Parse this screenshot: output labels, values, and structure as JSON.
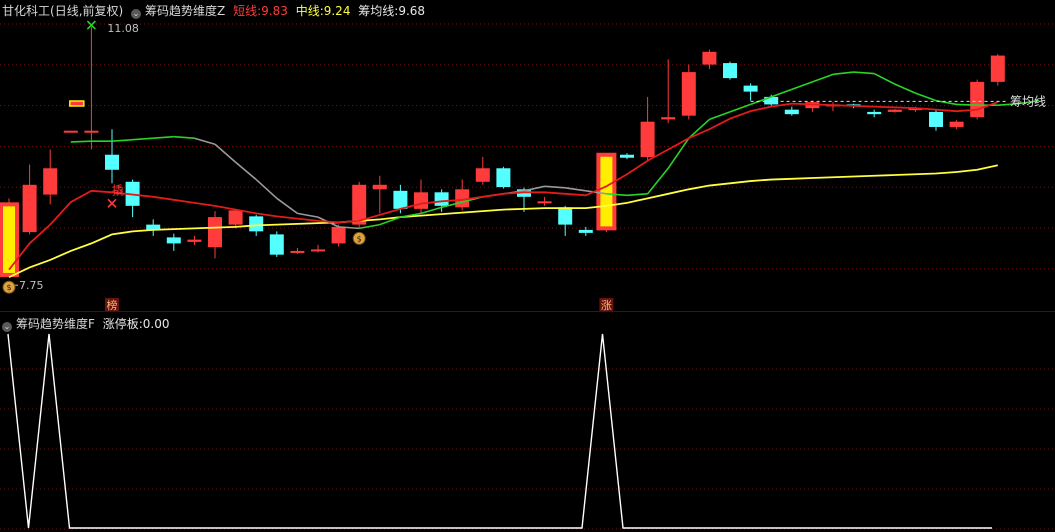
{
  "header": {
    "stock_name": "甘化科工",
    "period_label": "(日线,前复权)",
    "indicator": "筹码趋势维度Z",
    "short_label": "短线:",
    "short_value": "9.83",
    "mid_label": "中线:",
    "mid_value": "9.24",
    "avg_label": "筹均线:",
    "avg_value": "9.68"
  },
  "sub_header": {
    "indicator": "筹码趋势维度F",
    "label": "涨停板:",
    "value": "0.00"
  },
  "annotations": {
    "high_price": "11.08",
    "low_price": "7.75",
    "avg_line_label": "筹均线",
    "marker_escape": "撬",
    "marker_bar_1": "榜",
    "marker_bar_2": "涨"
  },
  "colors": {
    "up": "#ff3b3b",
    "down": "#54ffff",
    "short_line": "#e21b1b",
    "mid_line_up": "#ffff40",
    "trend_green": "#28d428",
    "trend_grey": "#9a9a9a",
    "grid": "#7a1010",
    "limit_up_fill": "#ffee00",
    "sub_line": "#ffffff"
  },
  "chart_data": [
    {
      "type": "candlestick",
      "title": "筹码趋势维度Z",
      "ylim": [
        7.5,
        11.2
      ],
      "high_annotation": 11.08,
      "low_annotation": 7.75,
      "candles": [
        {
          "o": 7.78,
          "c": 8.72,
          "h": 8.8,
          "l": 7.75,
          "limit_up": true
        },
        {
          "o": 8.35,
          "c": 8.98,
          "h": 9.25,
          "l": 8.32
        },
        {
          "o": 8.85,
          "c": 9.2,
          "h": 9.45,
          "l": 8.72
        },
        {
          "o": 9.7,
          "c": 9.7,
          "h": 9.7,
          "l": 9.7
        },
        {
          "o": 9.7,
          "c": 9.7,
          "h": 11.08,
          "l": 9.45
        },
        {
          "o": 9.38,
          "c": 9.18,
          "h": 9.72,
          "l": 9.0
        },
        {
          "o": 9.02,
          "c": 8.7,
          "h": 9.05,
          "l": 8.55
        },
        {
          "o": 8.45,
          "c": 8.38,
          "h": 8.52,
          "l": 8.3
        },
        {
          "o": 8.28,
          "c": 8.2,
          "h": 8.33,
          "l": 8.1
        },
        {
          "o": 8.22,
          "c": 8.25,
          "h": 8.3,
          "l": 8.18
        },
        {
          "o": 8.15,
          "c": 8.55,
          "h": 8.63,
          "l": 8.0
        },
        {
          "o": 8.45,
          "c": 8.64,
          "h": 8.66,
          "l": 8.4
        },
        {
          "o": 8.56,
          "c": 8.36,
          "h": 8.58,
          "l": 8.3
        },
        {
          "o": 8.32,
          "c": 8.05,
          "h": 8.36,
          "l": 8.02
        },
        {
          "o": 8.1,
          "c": 8.1,
          "h": 8.14,
          "l": 8.06
        },
        {
          "o": 8.12,
          "c": 8.12,
          "h": 8.18,
          "l": 8.08
        },
        {
          "o": 8.2,
          "c": 8.42,
          "h": 8.45,
          "l": 8.16
        },
        {
          "o": 8.45,
          "c": 8.98,
          "h": 9.02,
          "l": 8.4
        },
        {
          "o": 8.92,
          "c": 8.98,
          "h": 9.1,
          "l": 8.6
        },
        {
          "o": 8.9,
          "c": 8.66,
          "h": 8.98,
          "l": 8.6
        },
        {
          "o": 8.66,
          "c": 8.88,
          "h": 9.05,
          "l": 8.6
        },
        {
          "o": 8.88,
          "c": 8.7,
          "h": 8.92,
          "l": 8.62
        },
        {
          "o": 8.68,
          "c": 8.92,
          "h": 9.05,
          "l": 8.64
        },
        {
          "o": 9.02,
          "c": 9.2,
          "h": 9.35,
          "l": 8.98
        },
        {
          "o": 9.2,
          "c": 8.95,
          "h": 9.22,
          "l": 8.93
        },
        {
          "o": 8.92,
          "c": 8.82,
          "h": 8.94,
          "l": 8.62
        },
        {
          "o": 8.76,
          "c": 8.76,
          "h": 8.82,
          "l": 8.7
        },
        {
          "o": 8.68,
          "c": 8.45,
          "h": 8.7,
          "l": 8.3
        },
        {
          "o": 8.38,
          "c": 8.34,
          "h": 8.42,
          "l": 8.3
        },
        {
          "o": 8.4,
          "c": 9.38,
          "h": 9.4,
          "l": 8.35,
          "limit_up": true
        },
        {
          "o": 9.38,
          "c": 9.34,
          "h": 9.4,
          "l": 9.32
        },
        {
          "o": 9.35,
          "c": 9.82,
          "h": 10.15,
          "l": 9.3
        },
        {
          "o": 9.85,
          "c": 9.88,
          "h": 10.65,
          "l": 9.8
        },
        {
          "o": 9.9,
          "c": 10.48,
          "h": 10.58,
          "l": 9.85
        },
        {
          "o": 10.58,
          "c": 10.75,
          "h": 10.78,
          "l": 10.52
        },
        {
          "o": 10.6,
          "c": 10.4,
          "h": 10.62,
          "l": 10.38
        },
        {
          "o": 10.3,
          "c": 10.22,
          "h": 10.33,
          "l": 10.1
        },
        {
          "o": 10.15,
          "c": 10.05,
          "h": 10.18,
          "l": 10.02
        },
        {
          "o": 9.98,
          "c": 9.92,
          "h": 10.02,
          "l": 9.9
        },
        {
          "o": 10.0,
          "c": 10.08,
          "h": 10.1,
          "l": 9.95
        },
        {
          "o": 10.05,
          "c": 10.05,
          "h": 10.08,
          "l": 9.96
        },
        {
          "o": 10.05,
          "c": 10.04,
          "h": 10.06,
          "l": 10.0
        },
        {
          "o": 9.95,
          "c": 9.92,
          "h": 9.98,
          "l": 9.88
        },
        {
          "o": 9.95,
          "c": 9.98,
          "h": 9.99,
          "l": 9.94
        },
        {
          "o": 9.98,
          "c": 10.0,
          "h": 10.02,
          "l": 9.95
        },
        {
          "o": 9.95,
          "c": 9.75,
          "h": 9.97,
          "l": 9.7
        },
        {
          "o": 9.75,
          "c": 9.82,
          "h": 9.84,
          "l": 9.72
        },
        {
          "o": 9.88,
          "c": 10.35,
          "h": 10.38,
          "l": 9.85
        },
        {
          "o": 10.35,
          "c": 10.7,
          "h": 10.72,
          "l": 10.3
        }
      ],
      "short_line": [
        7.85,
        8.2,
        8.45,
        8.75,
        8.9,
        8.88,
        8.85,
        8.82,
        8.78,
        8.74,
        8.7,
        8.65,
        8.6,
        8.56,
        8.53,
        8.5,
        8.48,
        8.5,
        8.58,
        8.66,
        8.73,
        8.76,
        8.78,
        8.82,
        8.86,
        8.88,
        8.88,
        8.86,
        8.84,
        8.96,
        9.12,
        9.3,
        9.45,
        9.6,
        9.72,
        9.86,
        9.96,
        10.02,
        10.06,
        10.05,
        10.04,
        10.03,
        10.02,
        10.01,
        10.0,
        9.98,
        9.96,
        9.98,
        10.08
      ],
      "mid_line": [
        7.75,
        7.88,
        7.98,
        8.1,
        8.2,
        8.32,
        8.36,
        8.38,
        8.39,
        8.4,
        8.41,
        8.42,
        8.44,
        8.45,
        8.46,
        8.47,
        8.48,
        8.5,
        8.52,
        8.55,
        8.57,
        8.59,
        8.61,
        8.63,
        8.65,
        8.66,
        8.67,
        8.67,
        8.67,
        8.7,
        8.74,
        8.8,
        8.86,
        8.92,
        8.97,
        9.0,
        9.03,
        9.05,
        9.06,
        9.07,
        9.08,
        9.09,
        9.1,
        9.11,
        9.12,
        9.13,
        9.15,
        9.18,
        9.24
      ],
      "trend_line_start_index": 3,
      "trend_line": [
        9.55,
        9.56,
        9.56,
        9.58,
        9.6,
        9.62,
        9.6,
        9.52,
        9.28,
        9.05,
        8.8,
        8.6,
        8.55,
        8.42,
        8.4,
        8.45,
        8.55,
        8.6,
        8.68,
        8.75,
        8.82,
        8.86,
        8.9,
        8.96,
        8.94,
        8.9,
        8.86,
        8.84,
        8.86,
        9.2,
        9.6,
        9.85,
        9.95,
        10.05,
        10.15,
        10.25,
        10.35,
        10.45,
        10.48,
        10.46,
        10.32,
        10.2,
        10.1,
        10.05,
        10.04,
        10.04,
        10.06,
        10.1
      ],
      "trend_grey_indices": [
        9,
        10,
        11,
        12,
        13,
        14,
        15,
        16,
        24,
        25,
        26,
        27,
        28
      ],
      "chip_avg": 10.05,
      "markers": [
        {
          "index": 0,
          "type": "money-bag",
          "at": "low"
        },
        {
          "index": 17,
          "type": "money-bag",
          "at": "low"
        },
        {
          "index": 4,
          "type": "cross",
          "at": "high",
          "color": "#28d428"
        },
        {
          "index": 5,
          "type": "cross",
          "at": "low",
          "color": "#ff3b3b"
        },
        {
          "index": 3,
          "type": "flag",
          "at": "mid"
        }
      ]
    },
    {
      "type": "line",
      "title": "筹码趋势维度F",
      "series": [
        {
          "name": "涨停板",
          "values": [
            1,
            0,
            1,
            0,
            0,
            0,
            0,
            0,
            0,
            0,
            0,
            0,
            0,
            0,
            0,
            0,
            0,
            0,
            0,
            0,
            0,
            0,
            0,
            0,
            0,
            0,
            0,
            0,
            0,
            1,
            0,
            0,
            0,
            0,
            0,
            0,
            0,
            0,
            0,
            0,
            0,
            0,
            0,
            0,
            0,
            0,
            0,
            0,
            0
          ]
        }
      ],
      "ylim": [
        0,
        1
      ]
    }
  ]
}
